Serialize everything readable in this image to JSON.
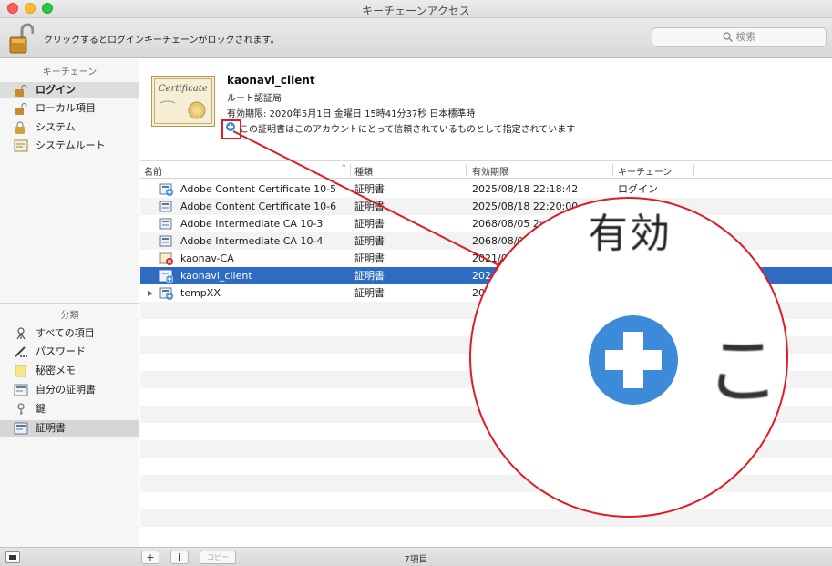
{
  "window": {
    "title": "キーチェーンアクセス"
  },
  "toolbar": {
    "lock_message": "クリックするとログインキーチェーンがロックされます。",
    "search_placeholder": "検索"
  },
  "sidebar": {
    "keychains_header": "キーチェーン",
    "keychains": [
      {
        "label": "ログイン",
        "icon": "lock-open-icon"
      },
      {
        "label": "ローカル項目",
        "icon": "lock-open-icon"
      },
      {
        "label": "システム",
        "icon": "lock-icon"
      },
      {
        "label": "システムルート",
        "icon": "certificate-icon"
      }
    ],
    "category_header": "分類",
    "categories": [
      {
        "label": "すべての項目",
        "icon": "all-items-icon"
      },
      {
        "label": "パスワード",
        "icon": "password-icon"
      },
      {
        "label": "秘密メモ",
        "icon": "secure-note-icon"
      },
      {
        "label": "自分の証明書",
        "icon": "my-certificate-icon"
      },
      {
        "label": "鍵",
        "icon": "key-icon"
      },
      {
        "label": "証明書",
        "icon": "certificate-icon"
      }
    ]
  },
  "detail": {
    "name": "kaonavi_client",
    "issuer": "ルート認証局",
    "expiry": "有効期限: 2020年5月1日 金曜日 15時41分37秒 日本標準時",
    "trust": "この証明書はこのアカウントにとって信頼されているものとして指定されています",
    "cert_image_text": "Certificate"
  },
  "table": {
    "columns": [
      "名前",
      "種類",
      "有効期限",
      "キーチェーン"
    ],
    "rows": [
      {
        "name": "Adobe Content Certificate 10-5",
        "kind": "証明書",
        "expires": "2025/08/18 22:18:42",
        "keychain": "ログイン"
      },
      {
        "name": "Adobe Content Certificate 10-6",
        "kind": "証明書",
        "expires": "2025/08/18 22:20:00",
        "keychain": ""
      },
      {
        "name": "Adobe Intermediate CA 10-3",
        "kind": "証明書",
        "expires": "2068/08/05 2:",
        "keychain": ""
      },
      {
        "name": "Adobe Intermediate CA 10-4",
        "kind": "証明書",
        "expires": "2068/08/0",
        "keychain": ""
      },
      {
        "name": "kaonav-CA",
        "kind": "証明書",
        "expires": "2021/0",
        "keychain": ""
      },
      {
        "name": "kaonavi_client",
        "kind": "証明書",
        "expires": "202",
        "keychain": ""
      },
      {
        "name": "tempXX",
        "kind": "証明書",
        "expires": "20",
        "keychain": ""
      }
    ]
  },
  "bottombar": {
    "copy_label": "コピー",
    "item_count": "7項目"
  },
  "zoom": {
    "top_text": "有効",
    "char": "こ"
  }
}
